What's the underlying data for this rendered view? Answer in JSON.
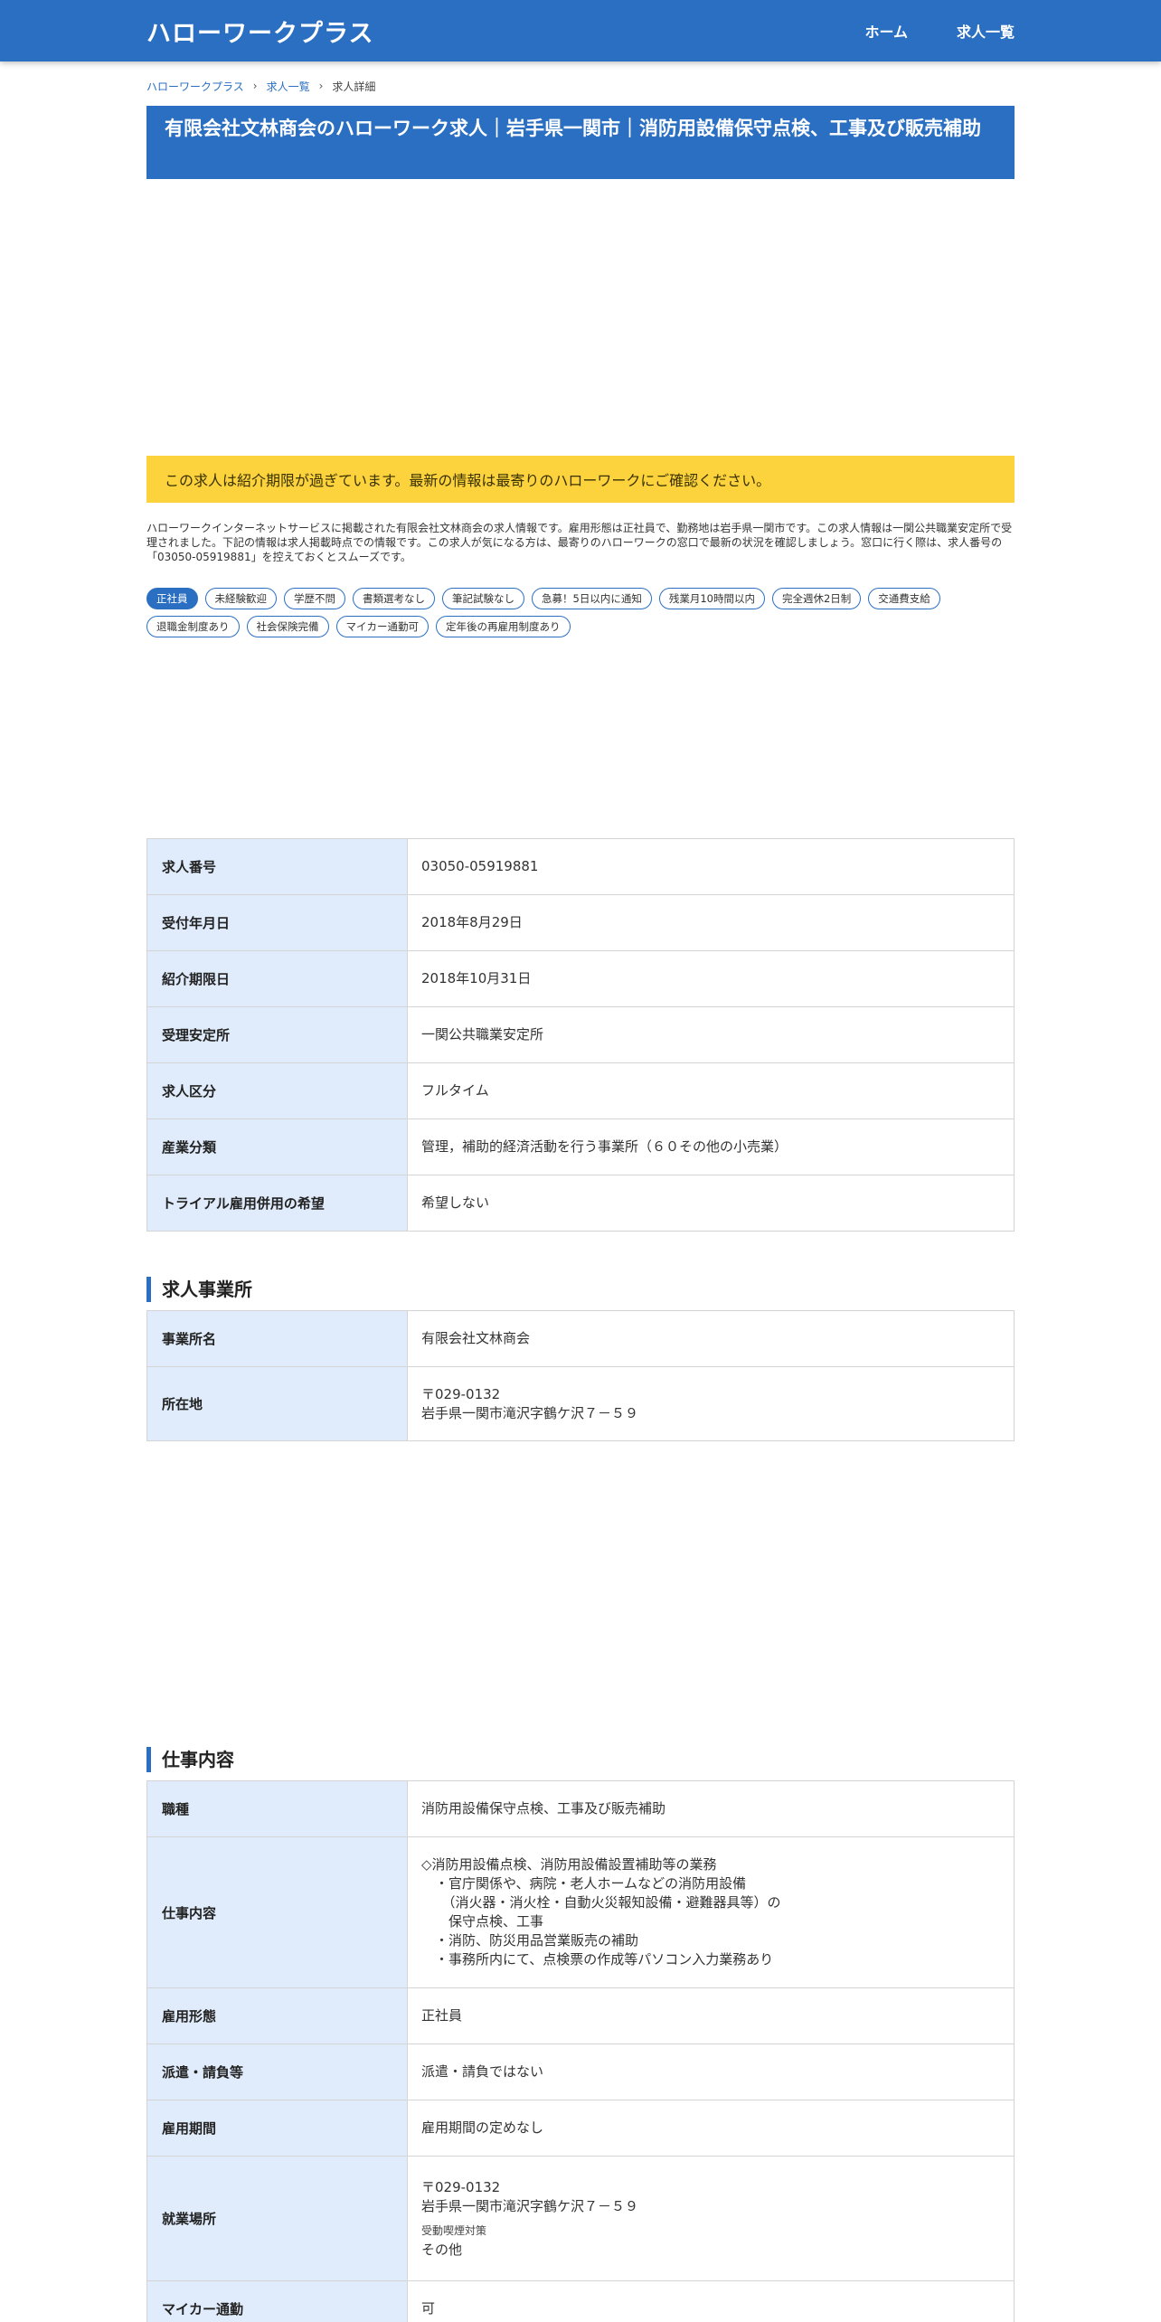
{
  "header": {
    "site_title": "ハローワークプラス",
    "nav": {
      "home": "ホーム",
      "job_list": "求人一覧"
    }
  },
  "breadcrumb": {
    "home": "ハローワークプラス",
    "job_list": "求人一覧",
    "current": "求人詳細"
  },
  "page_title": "有限会社文林商会のハローワーク求人｜岩手県一関市｜消防用設備保守点検、工事及び販売補助",
  "notice": "この求人は紹介期限が過ぎています。最新の情報は最寄りのハローワークにご確認ください。",
  "intro": "ハローワークインターネットサービスに掲載された有限会社文林商会の求人情報です。雇用形態は正社員で、勤務地は岩手県一関市です。この求人情報は一関公共職業安定所で受理されました。下記の情報は求人掲載時点での情報です。この求人が気になる方は、最寄りのハローワークの窓口で最新の状況を確認しましょう。窓口に行く際は、求人番号の「03050-05919881」を控えておくとスムーズです。",
  "tags": [
    "正社員",
    "未経験歓迎",
    "学歴不問",
    "書類選考なし",
    "筆記試験なし",
    "急募！5日以内に通知",
    "残業月10時間以内",
    "完全週休2日制",
    "交通費支給",
    "退職金制度あり",
    "社会保険完備",
    "マイカー通勤可",
    "定年後の再雇用制度あり"
  ],
  "summary": {
    "job_number_label": "求人番号",
    "job_number": "03050-05919881",
    "received_label": "受付年月日",
    "received": "2018年8月29日",
    "deadline_label": "紹介期限日",
    "deadline": "2018年10月31日",
    "office_label": "受理安定所",
    "office": "一関公共職業安定所",
    "category_label": "求人区分",
    "category": "フルタイム",
    "industry_label": "産業分類",
    "industry": "管理，補助的経済活動を行う事業所（６０その他の小売業）",
    "trial_label": "トライアル雇用併用の希望",
    "trial": "希望しない"
  },
  "employer": {
    "section_title": "求人事業所",
    "name_label": "事業所名",
    "name": "有限会社文林商会",
    "address_label": "所在地",
    "postal": "〒029-0132",
    "address": "岩手県一関市滝沢字鶴ケ沢７－５９"
  },
  "job": {
    "section_title": "仕事内容",
    "occupation_label": "職種",
    "occupation": "消防用設備保守点検、工事及び販売補助",
    "description_label": "仕事内容",
    "description": "◇消防用設備点検、消防用設備設置補助等の業務\n　・官庁関係や、病院・老人ホームなどの消防用設備\n　　（消火器・消火栓・自動火災報知設備・避難器具等）の\n　　保守点検、工事\n　・消防、防災用品営業販売の補助\n　・事務所内にて、点検票の作成等パソコン入力業務あり",
    "employment_type_label": "雇用形態",
    "employment_type": "正社員",
    "dispatch_label": "派遣・請負等",
    "dispatch": "派遣・請負ではない",
    "period_label": "雇用期間",
    "period": "雇用期間の定めなし",
    "workplace_label": "就業場所",
    "workplace_postal": "〒029-0132",
    "workplace_address": "岩手県一関市滝沢字鶴ケ沢７－５９",
    "smoking_label": "受動喫煙対策",
    "smoking": "その他",
    "car_label": "マイカー通勤",
    "car": "可"
  }
}
